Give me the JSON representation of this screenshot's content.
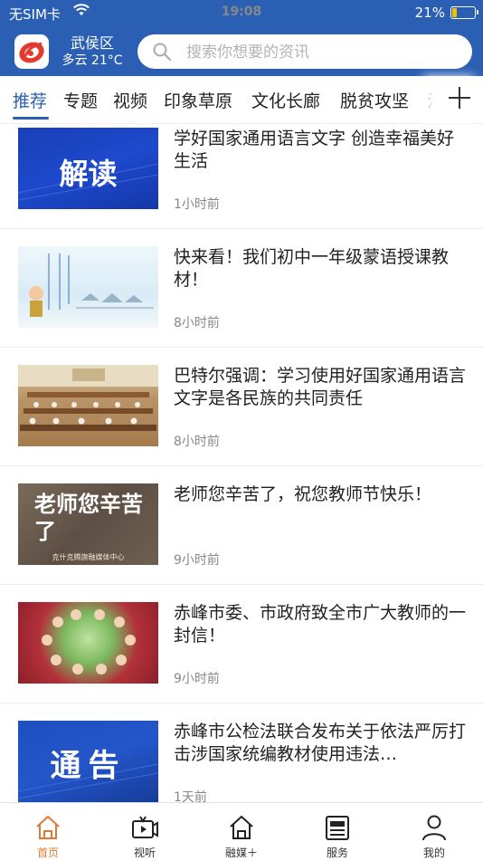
{
  "status_bar": {
    "carrier": "无SIM卡",
    "time": "19:08",
    "battery": "21%",
    "battery_level": 0.21
  },
  "header": {
    "city": "武侯区",
    "weather": "多云 21°C",
    "search_placeholder": "搜索你想要的资讯",
    "colors": {
      "brand": "#2b5fb3",
      "logo_red": "#e23b2e"
    }
  },
  "tabs": [
    {
      "label": "推荐",
      "active": true
    },
    {
      "label": "专题"
    },
    {
      "label": "视频"
    },
    {
      "label": "印象草原"
    },
    {
      "label": "文化长廊"
    },
    {
      "label": "脱贫攻坚"
    },
    {
      "label": "法"
    }
  ],
  "news": [
    {
      "title": "学好国家通用语言文字 创造幸福美好生活",
      "time": "1小时前",
      "thumb_text": "解读"
    },
    {
      "title": "快来看！我们初中一年级蒙语授课教材！",
      "time": "8小时前"
    },
    {
      "title": "巴特尔强调：学习使用好国家通用语言文字是各民族的共同责任",
      "time": "8小时前"
    },
    {
      "title": "老师您辛苦了，祝您教师节快乐！",
      "time": "9小时前",
      "thumb_text": "老师您辛苦了",
      "thumb_caption": "克什克腾旗融媒体中心"
    },
    {
      "title": "赤峰市委、市政府致全市广大教师的一封信！",
      "time": "9小时前"
    },
    {
      "title": "赤峰市公检法联合发布关于依法严厉打击涉国家统编教材使用违法…",
      "time": "1天前",
      "thumb_text": "通告"
    }
  ],
  "bottom_nav": [
    {
      "label": "首页",
      "icon": "home-icon",
      "active": true
    },
    {
      "label": "视听",
      "icon": "tv-icon"
    },
    {
      "label": "融媒＋",
      "icon": "house-icon"
    },
    {
      "label": "服务",
      "icon": "newspaper-icon"
    },
    {
      "label": "我的",
      "icon": "person-icon"
    }
  ]
}
